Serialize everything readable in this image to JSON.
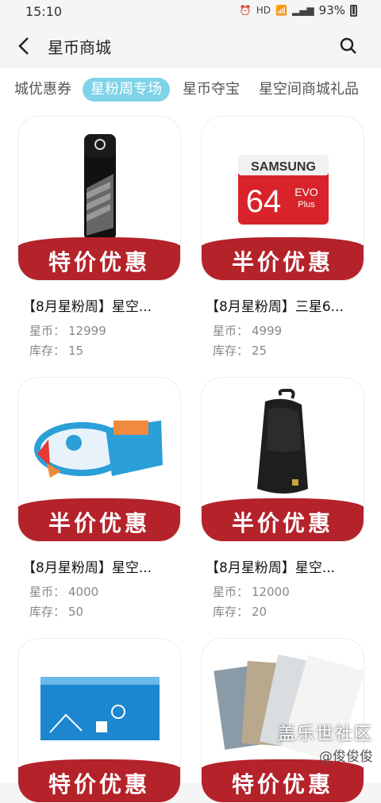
{
  "status_bar": {
    "time": "15:10",
    "hd": "HD",
    "battery": "93%"
  },
  "app_bar": {
    "title": "星币商城"
  },
  "tabs": [
    {
      "label": "城优惠券",
      "active": false
    },
    {
      "label": "星粉周专场",
      "active": true
    },
    {
      "label": "星币夺宝",
      "active": false
    },
    {
      "label": "星空间商城礼品",
      "active": false
    }
  ],
  "products": [
    {
      "name": "【8月星粉周】星空...",
      "banner": "特价优惠",
      "coin_label": "星币：",
      "coin": "12999",
      "stock_label": "库存：",
      "stock": "15",
      "image": "thermos"
    },
    {
      "name": "【8月星粉周】三星6...",
      "banner": "半价优惠",
      "coin_label": "星币：",
      "coin": "4999",
      "stock_label": "库存：",
      "stock": "25",
      "image": "sd-card"
    },
    {
      "name": "【8月星粉周】星空...",
      "banner": "半价优惠",
      "coin_label": "星币：",
      "coin": "4000",
      "stock_label": "库存：",
      "stock": "50",
      "image": "rocket-toy"
    },
    {
      "name": "【8月星粉周】星空...",
      "banner": "半价优惠",
      "coin_label": "星币：",
      "coin": "12000",
      "stock_label": "库存：",
      "stock": "20",
      "image": "sling-bag"
    },
    {
      "name": "",
      "banner": "特价优惠",
      "image": "notebook-box"
    },
    {
      "name": "",
      "banner": "特价优惠",
      "image": "postcards"
    }
  ],
  "sd_card": {
    "brand": "SAMSUNG",
    "capacity": "64",
    "evo": "EVO",
    "plus": "Plus"
  },
  "watermark": {
    "line1": "盖乐世社区",
    "line2": "@俊俊俊"
  },
  "colors": {
    "accent_tab": "#7fd3e8",
    "banner_red": "#b4222a"
  }
}
